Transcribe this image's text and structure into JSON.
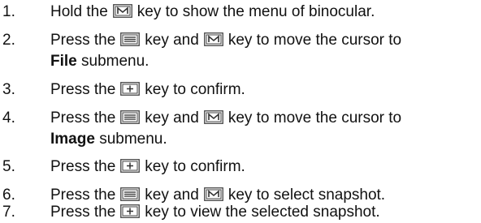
{
  "steps": [
    {
      "number": "1.",
      "lines": [
        {
          "parts": [
            {
              "t": "text",
              "v": "Hold the"
            },
            {
              "t": "key",
              "icon": "m-key-icon"
            },
            {
              "t": "text",
              "v": "key to show the menu of binocular."
            }
          ]
        }
      ]
    },
    {
      "number": "2.",
      "lines": [
        {
          "parts": [
            {
              "t": "text",
              "v": "Press the"
            },
            {
              "t": "key",
              "icon": "menu-key-icon"
            },
            {
              "t": "text",
              "v": "key and"
            },
            {
              "t": "key",
              "icon": "m-key-icon"
            },
            {
              "t": "text",
              "v": "key to move the cursor to"
            }
          ]
        },
        {
          "parts": [
            {
              "t": "bold",
              "v": "File"
            },
            {
              "t": "text",
              "v": "submenu."
            }
          ]
        }
      ]
    },
    {
      "number": "3.",
      "lines": [
        {
          "parts": [
            {
              "t": "text",
              "v": "Press the"
            },
            {
              "t": "key",
              "icon": "confirm-key-icon"
            },
            {
              "t": "text",
              "v": "key to confirm."
            }
          ]
        }
      ]
    },
    {
      "number": "4.",
      "lines": [
        {
          "parts": [
            {
              "t": "text",
              "v": "Press the"
            },
            {
              "t": "key",
              "icon": "menu-key-icon"
            },
            {
              "t": "text",
              "v": "key and"
            },
            {
              "t": "key",
              "icon": "m-key-icon"
            },
            {
              "t": "text",
              "v": "key to move the cursor to"
            }
          ]
        },
        {
          "parts": [
            {
              "t": "bold",
              "v": "Image"
            },
            {
              "t": "text",
              "v": "submenu."
            }
          ]
        }
      ]
    },
    {
      "number": "5.",
      "lines": [
        {
          "parts": [
            {
              "t": "text",
              "v": "Press the"
            },
            {
              "t": "key",
              "icon": "confirm-key-icon"
            },
            {
              "t": "text",
              "v": "key to confirm."
            }
          ]
        }
      ]
    },
    {
      "number": "6.",
      "lines": [
        {
          "parts": [
            {
              "t": "text",
              "v": "Press the"
            },
            {
              "t": "key",
              "icon": "menu-key-icon"
            },
            {
              "t": "text",
              "v": "key and"
            },
            {
              "t": "key",
              "icon": "m-key-icon"
            },
            {
              "t": "text",
              "v": "key to select snapshot."
            }
          ]
        }
      ]
    },
    {
      "number": "7.",
      "lines": [
        {
          "parts": [
            {
              "t": "text",
              "v": "Press the"
            },
            {
              "t": "key",
              "icon": "confirm-key-icon"
            },
            {
              "t": "text",
              "v": "key to view the selected snapshot."
            }
          ]
        }
      ]
    }
  ]
}
